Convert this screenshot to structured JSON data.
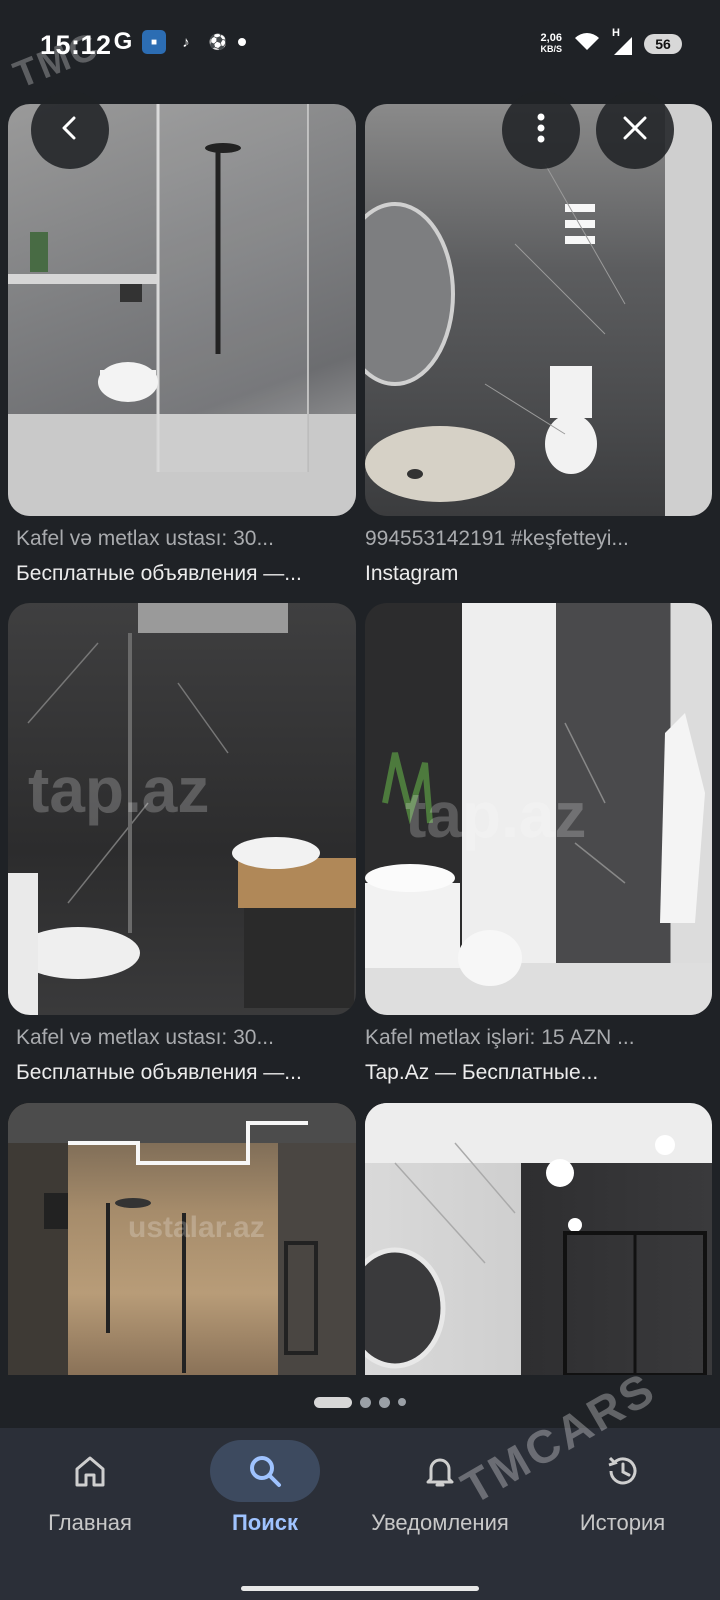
{
  "status_bar": {
    "time": "15:12",
    "apps": [
      "G",
      "■",
      "♪",
      "⚽"
    ],
    "net_speed": [
      "2,06",
      "KB/S"
    ],
    "network": "H",
    "battery": "56"
  },
  "watermarks": {
    "top": "TMC",
    "bottom": "TMCARS"
  },
  "results": [
    {
      "title": "Kafel və metlax ustası: 30...",
      "source": "Бесплатные объявления —..."
    },
    {
      "title": "994553142191 #keşfetteyi...",
      "source": "Instagram"
    },
    {
      "title": "Kafel və metlax ustası: 30...",
      "source": "Бесплатные объявления —..."
    },
    {
      "title": "Kafel metlax işləri: 15 AZN ...",
      "source": "Tap.Az — Бесплатные..."
    }
  ],
  "tile_watermarks": [
    "tap.az",
    "tap.az",
    "ustalar.az"
  ],
  "overlay": {
    "back_icon": "chevron-left-icon",
    "more_icon": "more-vert-icon",
    "close_icon": "close-icon"
  },
  "nav": [
    {
      "label": "Главная",
      "icon": "home-icon"
    },
    {
      "label": "Поиск",
      "icon": "search-icon"
    },
    {
      "label": "Уведомления",
      "icon": "bell-icon"
    },
    {
      "label": "История",
      "icon": "history-icon"
    }
  ],
  "colors": {
    "accent": "#9fc3ff",
    "nav_bg": "#2b2f38",
    "page_bg": "#1f2226"
  }
}
